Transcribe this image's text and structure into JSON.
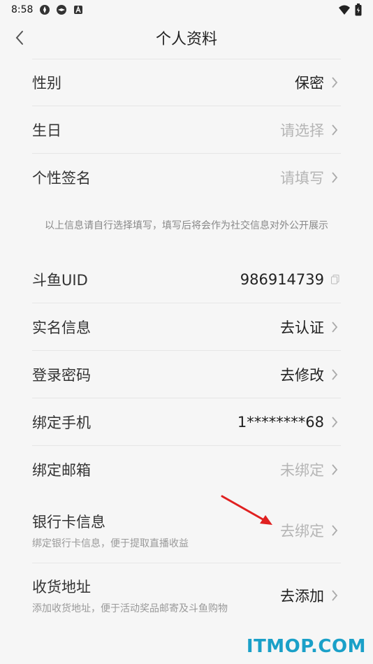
{
  "status_bar": {
    "time": "8:58"
  },
  "header": {
    "title": "个人资料"
  },
  "profile": [
    {
      "label": "性别",
      "value": "保密"
    },
    {
      "label": "生日",
      "value": "请选择"
    },
    {
      "label": "个性签名",
      "value": "请填写"
    }
  ],
  "note": "以上信息请自行选择填写，填写后将会作为社交信息对外公开展示",
  "account": [
    {
      "label": "斗鱼UID",
      "value": "986914739"
    },
    {
      "label": "实名信息",
      "value": "去认证"
    },
    {
      "label": "登录密码",
      "value": "去修改"
    },
    {
      "label": "绑定手机",
      "value": "1********68"
    },
    {
      "label": "绑定邮箱",
      "value": "未绑定"
    },
    {
      "label": "银行卡信息",
      "sub": "绑定银行卡信息，便于提取直播收益",
      "value": "去绑定"
    },
    {
      "label": "收货地址",
      "sub": "添加收货地址，便于活动奖品邮寄及斗鱼购物",
      "value": "去添加"
    }
  ],
  "watermark": "ITMOP.COM",
  "colors": {
    "background": "#f6f6f6",
    "placeholder": "#b5b5b5",
    "annotation_arrow": "#e02020",
    "watermark": "#1aa0c8"
  }
}
